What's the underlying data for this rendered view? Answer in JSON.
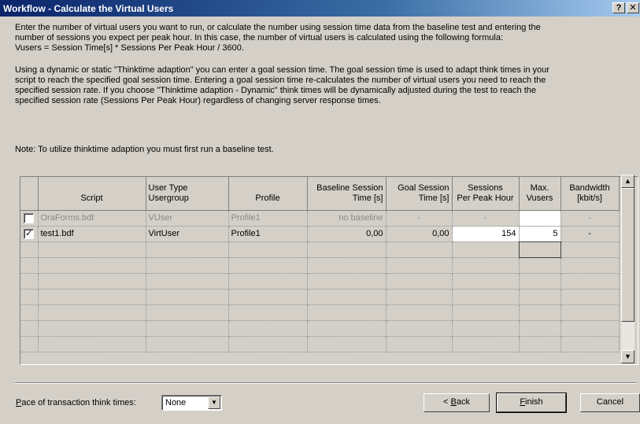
{
  "window": {
    "title": "Workflow - Calculate the Virtual Users",
    "help_label": "?",
    "close_label": "✕"
  },
  "intro": {
    "line1": "Enter the number of virtual users you want to run, or calculate the number using session time data from the baseline test and entering the",
    "line2": "number of sessions you expect per peak hour. In this case, the number of virtual users is calculated using the following formula:",
    "line3": "Vusers = Session Time[s] * Sessions Per Peak Hour / 3600.",
    "line4": "Using a dynamic or static \"Thinktime adaption\" you can enter a goal session time. The goal session time is used to adapt think times in your",
    "line5": "script to reach the specified goal session time. Entering a goal session time re-calculates the number of virtual users you need to reach the",
    "line6": "specified session rate. If you choose \"Thinktime adaption - Dynamic\" think times will be dynamically adjusted during the test to reach the",
    "line7": "specified session rate (Sessions Per Peak Hour) regardless of changing server response times.",
    "note": "Note: To utilize thinktime adaption you must first run a baseline test."
  },
  "grid": {
    "headers": {
      "script": "Script",
      "usertype_1": "User Type",
      "usertype_2": "Usergroup",
      "profile": "Profile",
      "baseline_1": "Baseline Session",
      "baseline_2": "Time [s]",
      "goal_1": "Goal Session",
      "goal_2": "Time [s]",
      "sessions_1": "Sessions",
      "sessions_2": "Per Peak Hour",
      "max_1": "Max.",
      "max_2": "Vusers",
      "bw_1": "Bandwidth",
      "bw_2": "[kbit/s]"
    },
    "rows": [
      {
        "checked": false,
        "check_mark": "",
        "script": "OraForms.bdf",
        "usertype": "VUser",
        "profile": "Profile1",
        "baseline": "no baseline",
        "goal": "-",
        "sessions": "-",
        "max_vusers": "",
        "bandwidth": "-"
      },
      {
        "checked": true,
        "check_mark": "✓",
        "script": "test1.bdf",
        "usertype": "VirtUser",
        "profile": "Profile1",
        "baseline": "0,00",
        "goal": "0,00",
        "sessions": "154",
        "max_vusers": "5",
        "bandwidth": "-"
      }
    ]
  },
  "scrollbar": {
    "up_icon": "▲",
    "down_icon": "▼"
  },
  "footer": {
    "pace_label_first": "P",
    "pace_label_rest": "ace of transaction think times:",
    "pace_value": "None",
    "pace_arrow": "▼",
    "back_prefix": "< ",
    "back_accel": "B",
    "back_rest": "ack",
    "finish_accel": "F",
    "finish_rest": "inish",
    "cancel_label": "Cancel"
  },
  "colors": {
    "dialog_bg": "#d4d0c8",
    "title_start": "#0a246a",
    "title_end": "#a6caf0",
    "disabled_text": "#8a8a8a"
  }
}
